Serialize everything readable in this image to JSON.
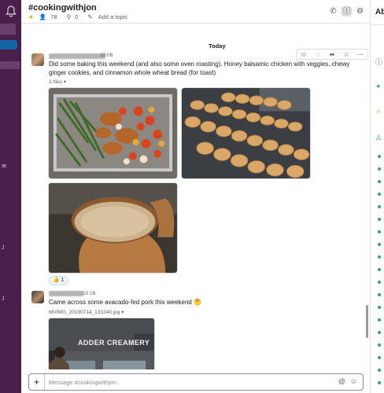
{
  "sidebar": {
    "tiny_labels": [
      "æ",
      "J",
      "J"
    ]
  },
  "header": {
    "channel": "#cookingwithjon",
    "star": "★",
    "members": "78",
    "pins": "0",
    "topic_link": "Add a topic",
    "icons": [
      "phone-icon",
      "info-icon",
      "gear-icon"
    ]
  },
  "right_sidebar": {
    "label": "Ab"
  },
  "feed": {
    "date_divider": "Today",
    "toolbar_icons": [
      "add-reaction-icon",
      "reply-icon",
      "share-icon",
      "bookmark-icon",
      "more-icon"
    ],
    "toolbar_glyphs": [
      "☺",
      "◌",
      "➦",
      "☆",
      "⋯"
    ],
    "message1": {
      "time": "10:06",
      "text": "Did some baking this weekend (and also some oven roasting).  Honey balsamic chicken with veggies, chewy ginger cookies, and cinnamon whole wheat bread (for toast)",
      "files": "3 files ▾",
      "reaction": "👍 1"
    },
    "message2": {
      "time": "10:16",
      "text": "Came across some avacado-fed pork this weekend 🤔",
      "file_name": "MVIMG_20190714_131240.jpg ▾",
      "sign_text": "ADDER CREAMERY"
    }
  },
  "composer": {
    "placeholder": "Message #cookingwithjon",
    "value": ""
  }
}
